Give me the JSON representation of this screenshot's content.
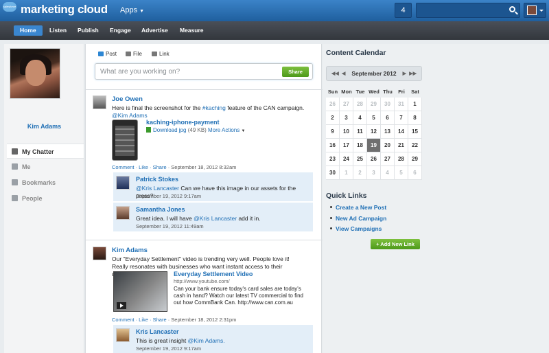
{
  "header": {
    "logo_small": "salesforce",
    "logo": "marketing cloud",
    "apps_label": "Apps",
    "notification_count": "4",
    "search_icon": "search-icon",
    "profile_menu_icon": "chevron-down-icon"
  },
  "nav": {
    "items": [
      "Home",
      "Listen",
      "Publish",
      "Engage",
      "Advertise",
      "Measure"
    ],
    "active": "Home"
  },
  "profile": {
    "name": "Kim Adams"
  },
  "left_nav": {
    "items": [
      "My Chatter",
      "Me",
      "Bookmarks",
      "People"
    ],
    "active": "My Chatter"
  },
  "publisher": {
    "tabs": [
      "Post",
      "File",
      "Link"
    ],
    "placeholder": "What are you working on?",
    "share_label": "Share"
  },
  "feed": [
    {
      "author": "Joe Owen",
      "text_before": "Here is final the screenshot for the ",
      "hashtag": "#kaching",
      "text_mid": " feature of the CAN campaign. ",
      "mention": "@Kim Adams",
      "attachment": {
        "name": "kaching-iphone-payment",
        "download_label": "Download jpg",
        "size": "(49 KB)",
        "more_actions": "More Actions"
      },
      "actions": "Comment · Like · Share",
      "timestamp": "September 18, 2012 8:32am",
      "comments": [
        {
          "author": "Patrick Stokes",
          "mention": "@Kris Lancaster",
          "text": " Can we have this image in our assets for the press?",
          "timestamp": "September 19, 2012 9:17am"
        },
        {
          "author": "Samantha Jones",
          "text_before": "Great idea. I will have ",
          "mention": "@Kris Lancaster",
          "text_after": " add it in.",
          "timestamp": "September 19, 2012 11:49am"
        }
      ]
    },
    {
      "author": "Kim Adams",
      "text": "Our \"Everyday Settlement\" video is trending very well. People love it! Really resonates with businesses who want instant access to their deposits.",
      "video": {
        "title": "Everyday Settlement Video",
        "url": "http://www.youtube.com/",
        "description": "Can your bank ensure today's card sales are today's cash in hand? Watch our latest TV commercial to find out how CommBank Can.",
        "link": "http://www.can.com.au"
      },
      "actions": "Comment · Like · Share",
      "timestamp": "September 18, 2012 2:31pm",
      "comments": [
        {
          "author": "Kris Lancaster",
          "text_before": "This is great insight ",
          "mention": "@Kim Adams.",
          "timestamp": "September 19, 2012 9:17am"
        }
      ]
    }
  ],
  "calendar": {
    "title": "Content Calendar",
    "month": "September 2012",
    "days_of_week": [
      "Sun",
      "Mon",
      "Tue",
      "Wed",
      "Thu",
      "Fri",
      "Sat"
    ],
    "weeks": [
      [
        "26",
        "27",
        "28",
        "29",
        "30",
        "31",
        "1"
      ],
      [
        "2",
        "3",
        "4",
        "5",
        "6",
        "7",
        "8"
      ],
      [
        "9",
        "10",
        "11",
        "12",
        "13",
        "14",
        "15"
      ],
      [
        "16",
        "17",
        "18",
        "19",
        "20",
        "21",
        "22"
      ],
      [
        "23",
        "24",
        "25",
        "26",
        "27",
        "28",
        "29"
      ],
      [
        "30",
        "1",
        "2",
        "3",
        "4",
        "5",
        "6"
      ]
    ],
    "today": "19"
  },
  "quick_links": {
    "title": "Quick Links",
    "items": [
      "Create a New Post",
      "New Ad Campaign",
      "View Campaigns"
    ],
    "add_label": "+ Add New Link"
  },
  "colors": {
    "header": "#2a6fb6",
    "nav": "#3d4249",
    "link": "#1f6fb5",
    "button_green": "#5aa826",
    "comment_bg": "#e3eef8"
  }
}
